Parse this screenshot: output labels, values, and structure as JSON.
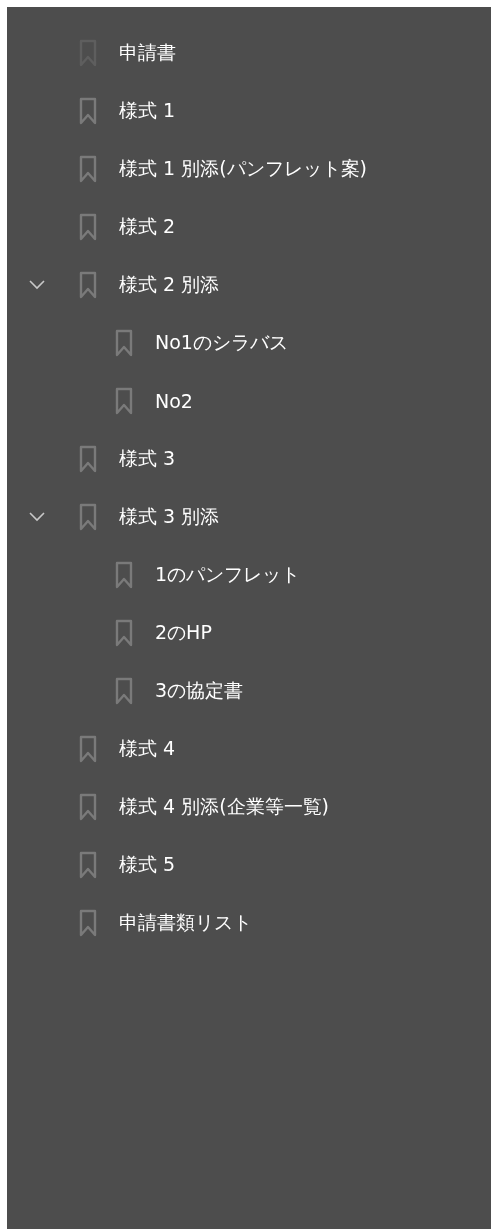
{
  "bookmarks": [
    {
      "label": "申請書",
      "dimmed": true
    },
    {
      "label": "様式 1",
      "dimmed": false
    },
    {
      "label": "様式 1 別添(パンフレット案)",
      "dimmed": false
    },
    {
      "label": "様式 2",
      "dimmed": false
    },
    {
      "label": "様式 2 別添",
      "dimmed": false,
      "expanded": true,
      "children": [
        {
          "label": "No1のシラバス",
          "dimmed": false
        },
        {
          "label": "No2",
          "dimmed": false
        }
      ]
    },
    {
      "label": "様式 3",
      "dimmed": false
    },
    {
      "label": "様式 3 別添",
      "dimmed": false,
      "expanded": true,
      "children": [
        {
          "label": "1のパンフレット",
          "dimmed": false
        },
        {
          "label": "2のHP",
          "dimmed": false
        },
        {
          "label": "3の協定書",
          "dimmed": false
        }
      ]
    },
    {
      "label": "様式 4",
      "dimmed": false
    },
    {
      "label": "様式 4 別添(企業等一覧)",
      "dimmed": false
    },
    {
      "label": "様式 5",
      "dimmed": false
    },
    {
      "label": "申請書類リスト",
      "dimmed": false
    }
  ]
}
